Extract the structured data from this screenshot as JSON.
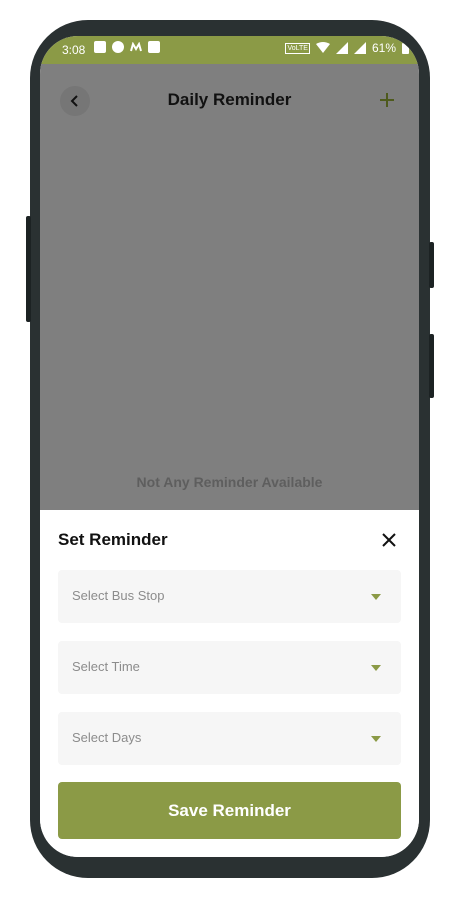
{
  "status_bar": {
    "time": "3:08",
    "battery": "61%",
    "network_badge": "VoLTE",
    "left_icons": [
      "sim-icon",
      "app-icon",
      "m-icon",
      "image-icon"
    ],
    "right_icons": [
      "volte-icon",
      "wifi-icon",
      "signal-icon",
      "signal-icon",
      "battery-icon"
    ]
  },
  "header": {
    "title": "Daily Reminder",
    "back_icon": "chevron-left-icon",
    "add_icon": "plus-icon"
  },
  "empty_state": {
    "message": "Not Any Reminder Available"
  },
  "sheet": {
    "title": "Set Reminder",
    "close_icon": "close-icon",
    "fields": [
      {
        "placeholder": "Select Bus Stop"
      },
      {
        "placeholder": "Select Time"
      },
      {
        "placeholder": "Select Days"
      }
    ],
    "save_label": "Save Reminder"
  },
  "colors": {
    "accent": "#8b9a46",
    "overlay": "#7f7f7f",
    "field_bg": "#f6f6f6",
    "frame": "#2a3132"
  }
}
